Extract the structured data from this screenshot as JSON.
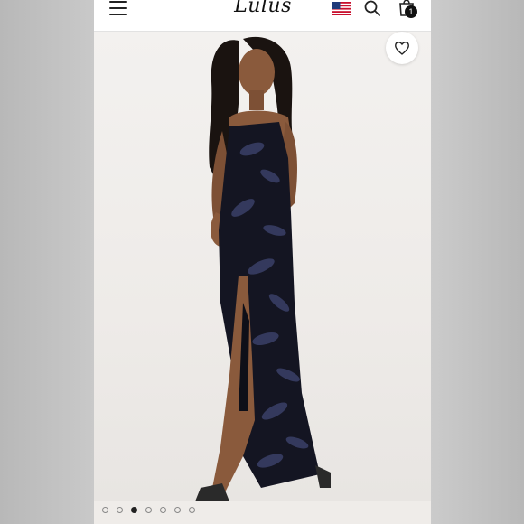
{
  "header": {
    "logo_text": "Lulus",
    "menu_icon": "hamburger-menu-icon",
    "flag_icon": "us-flag-icon",
    "search_icon": "search-icon",
    "bag_icon": "shopping-bag-icon",
    "bag_count": "1"
  },
  "product_image": {
    "wishlist_icon": "heart-icon"
  },
  "carousel": {
    "total_dots": 7,
    "active_index": 2
  },
  "colors": {
    "background": "#bdbdbd",
    "header_bg": "#ffffff",
    "photo_bg": "#efece9",
    "dress": "#141522",
    "sequin": "#3a4068"
  }
}
